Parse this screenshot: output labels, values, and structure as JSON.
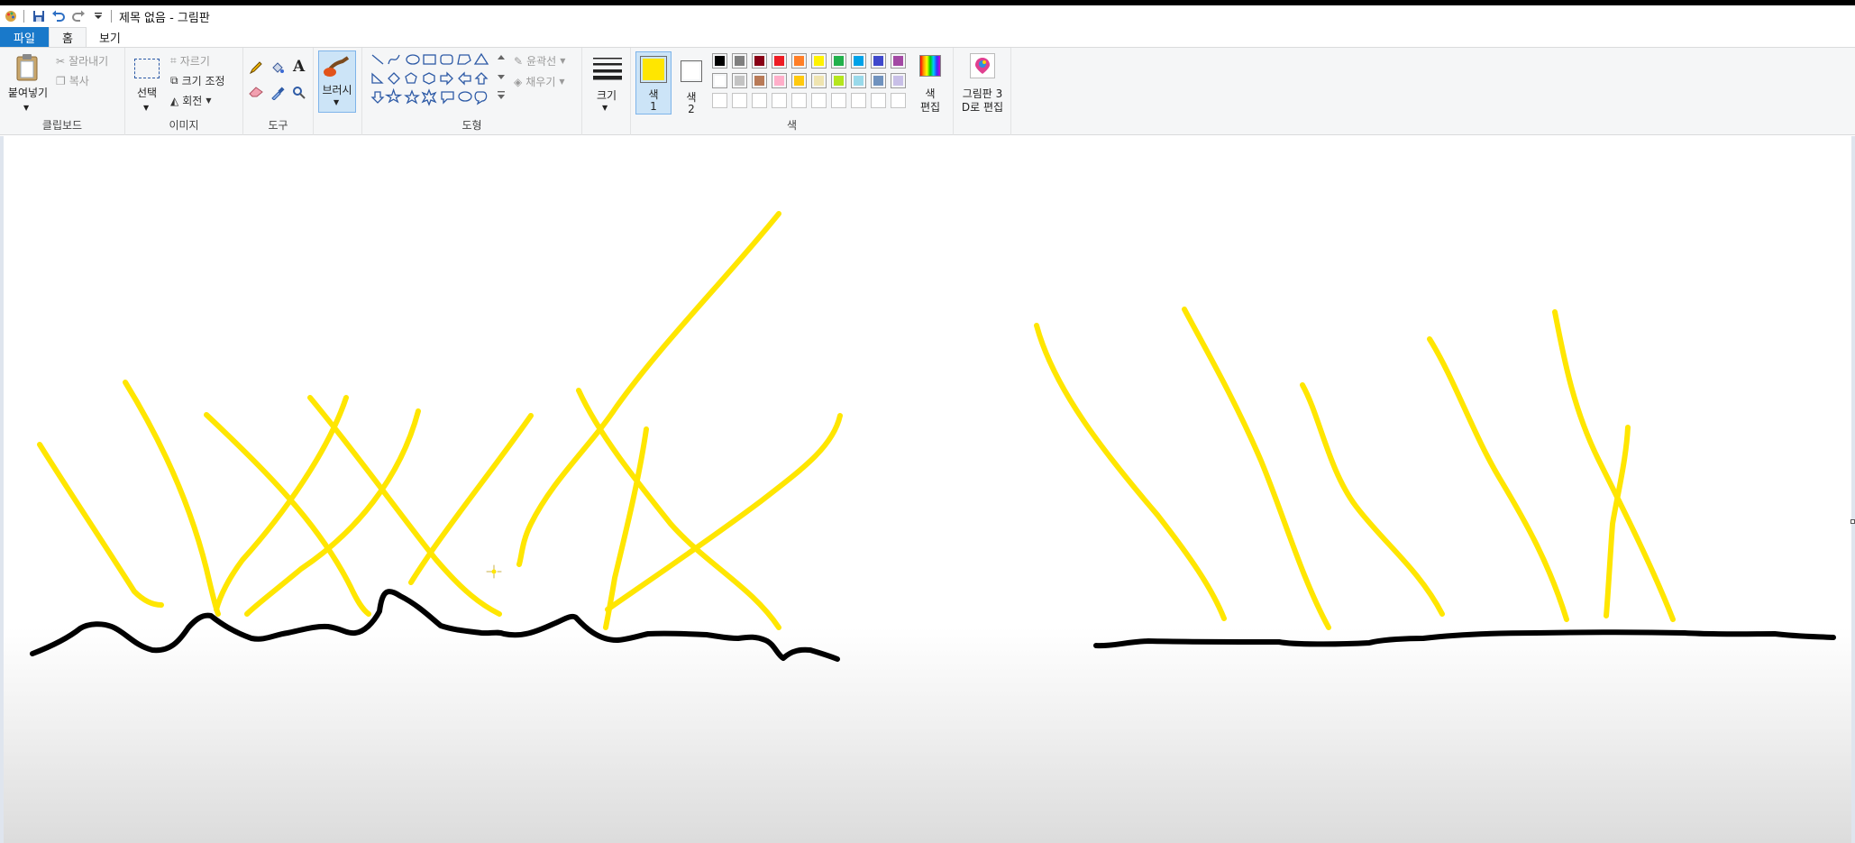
{
  "window": {
    "title": "제목 없음 - 그림판"
  },
  "quick_access": {
    "icons": [
      "paint-app-icon",
      "save-icon",
      "undo-icon",
      "redo-icon",
      "customize-dropdown-icon"
    ]
  },
  "tabs": [
    {
      "label": "파일"
    },
    {
      "label": "홈"
    },
    {
      "label": "보기"
    }
  ],
  "ribbon": {
    "clipboard": {
      "label": "클립보드",
      "paste": "붙여넣기",
      "cut": "잘라내기",
      "copy": "복사"
    },
    "image": {
      "label": "이미지",
      "select": "선택",
      "crop": "자르기",
      "resize": "크기 조정",
      "rotate": "회전"
    },
    "tools": {
      "label": "도구",
      "brush": "브러시"
    },
    "shapes": {
      "label": "도형",
      "outline": "윤곽선",
      "fill": "채우기"
    },
    "size": {
      "label": "크기"
    },
    "colors": {
      "label": "색",
      "color1_top": "색",
      "color1_bottom": "1",
      "color2_top": "색",
      "color2_bottom": "2",
      "edit_top": "색",
      "edit_bottom": "편집",
      "color1_value": "#ffe600",
      "color2_value": "#ffffff",
      "palette_row1": [
        "#000000",
        "#7f7f7f",
        "#880015",
        "#ed1c24",
        "#ff7f27",
        "#fff200",
        "#22b14c",
        "#00a2e8",
        "#3f48cc",
        "#a349a4"
      ],
      "palette_row2": [
        "#ffffff",
        "#c3c3c3",
        "#b97a57",
        "#ffaec9",
        "#ffc90e",
        "#efe4b0",
        "#b5e61d",
        "#99d9ea",
        "#7092be",
        "#c8bfe7"
      ]
    },
    "paint3d": {
      "line1": "그림판 3",
      "line2": "D로 편집"
    }
  },
  "canvas": {
    "stroke_colors": {
      "ground": "#000000",
      "rays": "#ffe600"
    }
  }
}
